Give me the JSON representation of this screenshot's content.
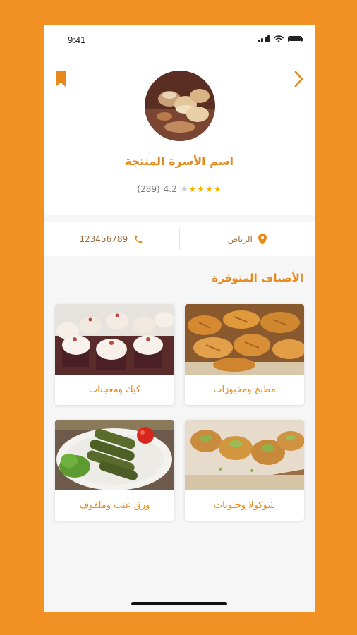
{
  "status_bar": {
    "time": "9:41"
  },
  "header": {
    "shop_name": "اسم الأسرة المنتجة",
    "rating": "4.2",
    "reviews": "(289)",
    "stars_filled": 4,
    "stars_total": 5
  },
  "info": {
    "location": "الرياض",
    "phone": "123456789"
  },
  "section_title": "الأصناف المتوفرة",
  "categories": [
    {
      "label": "مطبخ ومخبوزات"
    },
    {
      "label": "كيك ومعجنات"
    },
    {
      "label": "شوكولا وحلويات"
    },
    {
      "label": "ورق عنب وملفوف"
    }
  ],
  "colors": {
    "accent": "#e58a1a",
    "background": "#f39224",
    "star": "#f7b500"
  }
}
